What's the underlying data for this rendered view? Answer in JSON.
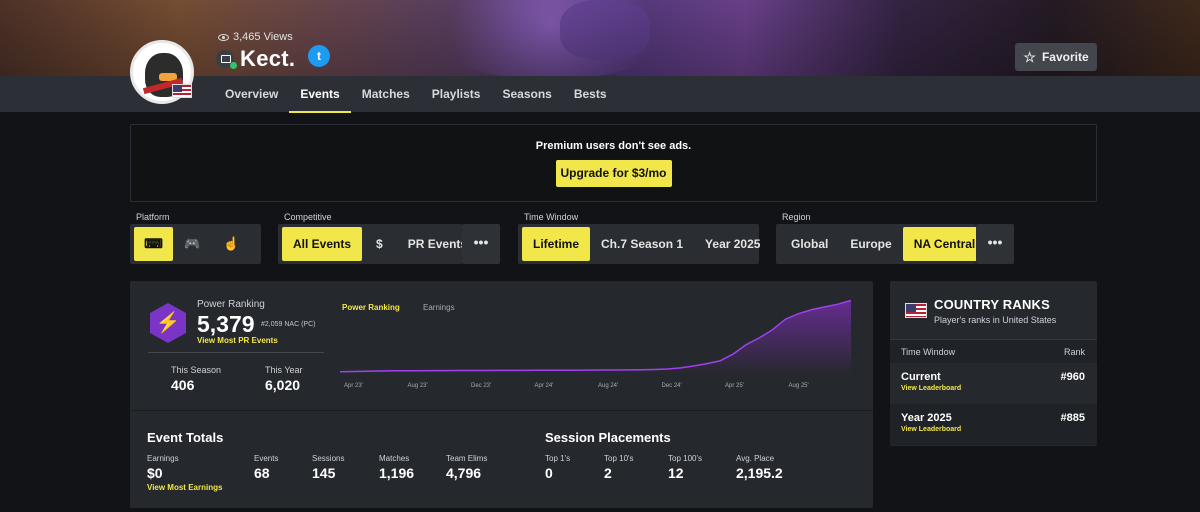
{
  "profile": {
    "views": "3,465 Views",
    "name": "Kect.",
    "twitter_glyph": "t",
    "favorite_label": "Favorite"
  },
  "nav": {
    "tabs": [
      {
        "label": "Overview"
      },
      {
        "label": "Events",
        "active": true
      },
      {
        "label": "Matches"
      },
      {
        "label": "Playlists"
      },
      {
        "label": "Seasons"
      },
      {
        "label": "Bests"
      }
    ]
  },
  "ad": {
    "message": "Premium users don't see ads.",
    "upgrade_label": "Upgrade for $3/mo"
  },
  "filters": {
    "platform": {
      "label": "Platform",
      "icons": [
        "keyboard-icon",
        "gamepad-icon",
        "touch-icon"
      ]
    },
    "competitive": {
      "label": "Competitive",
      "options": [
        "All Events",
        "$",
        "PR Events"
      ]
    },
    "time_window": {
      "label": "Time Window",
      "options": [
        "Lifetime",
        "Ch.7 Season 1",
        "Year 2025"
      ]
    },
    "region": {
      "label": "Region",
      "options": [
        "Global",
        "Europe",
        "NA Central"
      ]
    },
    "more_glyph": "•••"
  },
  "power_ranking": {
    "badge_glyph": "⚡",
    "title": "Power Ranking",
    "value": "5,379",
    "rank_text": "#2,059 NAC (PC)",
    "link": "View Most PR Events",
    "this_season_label": "This Season",
    "this_season_value": "406",
    "this_year_label": "This Year",
    "this_year_value": "6,020",
    "tabs": [
      "Power Ranking",
      "Earnings"
    ]
  },
  "chart_data": {
    "type": "area",
    "x_ticks": [
      "Apr 23'",
      "Aug 23'",
      "Dec 23'",
      "Apr 24'",
      "Aug 24'",
      "Dec 24'",
      "Apr 25'",
      "Aug 25'"
    ],
    "series": [
      {
        "values": [
          100,
          110,
          130,
          150,
          160,
          165,
          170,
          175,
          180,
          182,
          185,
          188,
          190,
          192,
          195,
          198,
          200,
          205,
          210,
          215,
          220,
          225,
          230,
          240,
          260,
          300,
          380,
          520,
          700,
          900,
          1400,
          2100,
          2600,
          3200,
          4000,
          4400,
          4700,
          4900,
          5100,
          5379
        ]
      }
    ]
  },
  "event_totals": {
    "title": "Event Totals",
    "stats": [
      {
        "label": "Earnings",
        "value": "$0"
      },
      {
        "label": "Events",
        "value": "68"
      },
      {
        "label": "Sessions",
        "value": "145"
      },
      {
        "label": "Matches",
        "value": "1,196"
      },
      {
        "label": "Team Elims",
        "value": "4,796"
      }
    ],
    "link": "View Most Earnings"
  },
  "session_placements": {
    "title": "Session Placements",
    "stats": [
      {
        "label": "Top 1's",
        "value": "0"
      },
      {
        "label": "Top 10's",
        "value": "2"
      },
      {
        "label": "Top 100's",
        "value": "12"
      },
      {
        "label": "Avg. Place",
        "value": "2,195.2"
      }
    ]
  },
  "country_ranks": {
    "title": "COUNTRY RANKS",
    "subtitle": "Player's ranks in United States",
    "col_time": "Time Window",
    "col_rank": "Rank",
    "rows": [
      {
        "window": "Current",
        "link": "View Leaderboard",
        "rank": "#960"
      },
      {
        "window": "Year 2025",
        "link": "View Leaderboard",
        "rank": "#885"
      }
    ]
  },
  "colors": {
    "accent": "#f2e74a",
    "purple": "#9b30e0",
    "panel": "#25282d",
    "bg": "#121316"
  }
}
